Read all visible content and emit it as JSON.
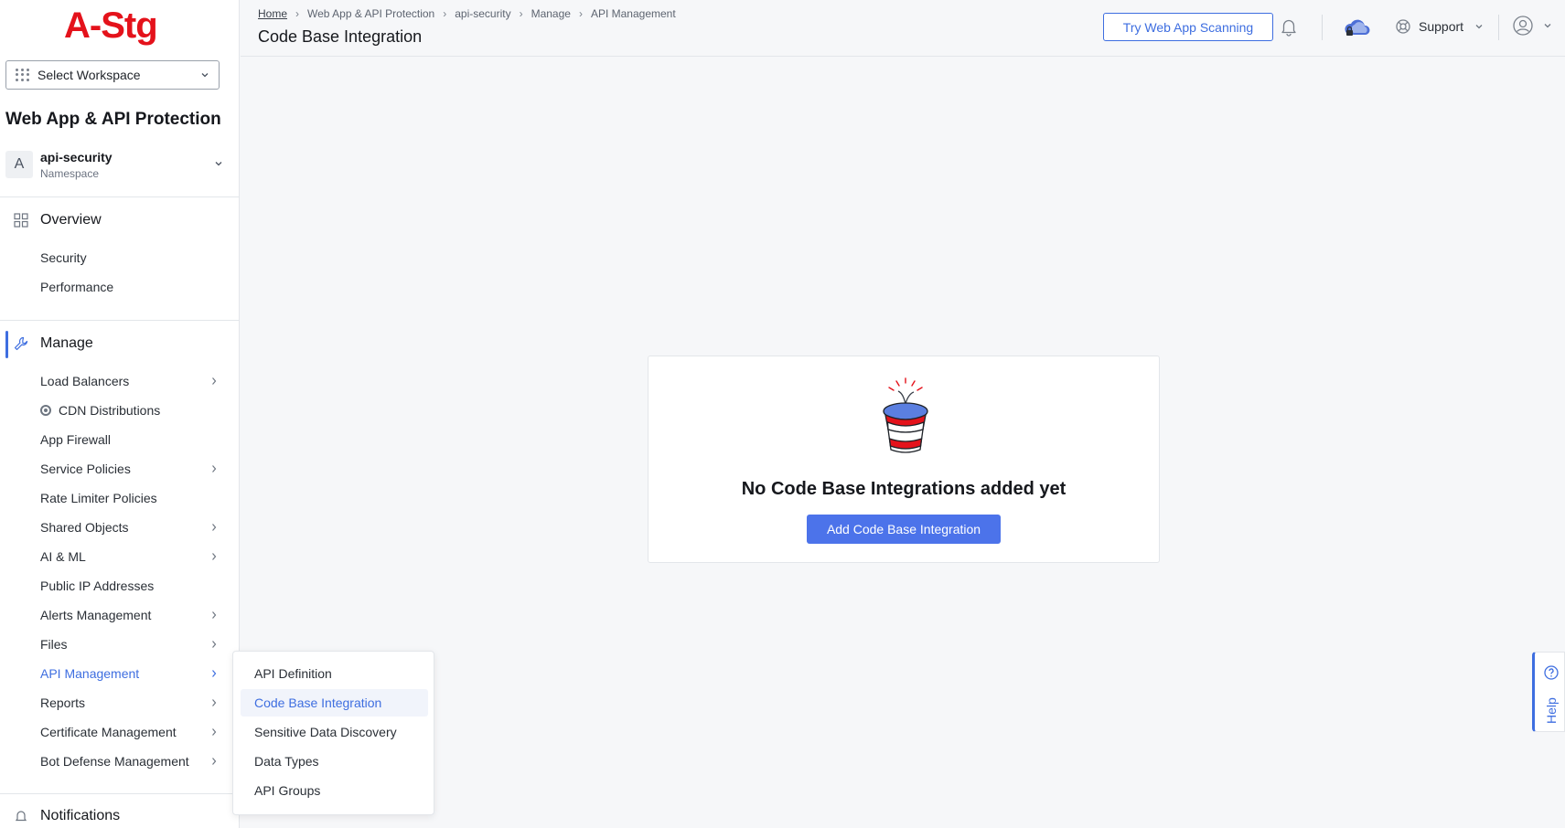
{
  "brand": {
    "logo_text": "A-Stg",
    "logo_color": "#e4121b",
    "accent": "#3e6ee0"
  },
  "workspace": {
    "label": "Select Workspace"
  },
  "app": {
    "title": "Web App & API Protection"
  },
  "namespace": {
    "avatar": "A",
    "name": "api-security",
    "sub": "Namespace"
  },
  "sidebar": {
    "overview": {
      "label": "Overview",
      "items": [
        {
          "label": "Security"
        },
        {
          "label": "Performance"
        }
      ]
    },
    "manage": {
      "label": "Manage",
      "items": [
        {
          "label": "Load Balancers",
          "has_arrow": true
        },
        {
          "label": "CDN Distributions",
          "has_arrow": false
        },
        {
          "label": "App Firewall",
          "has_arrow": false
        },
        {
          "label": "Service Policies",
          "has_arrow": true
        },
        {
          "label": "Rate Limiter Policies",
          "has_arrow": false
        },
        {
          "label": "Shared Objects",
          "has_arrow": true
        },
        {
          "label": "AI & ML",
          "has_arrow": true
        },
        {
          "label": "Public IP Addresses",
          "has_arrow": false
        },
        {
          "label": "Alerts Management",
          "has_arrow": true
        },
        {
          "label": "Files",
          "has_arrow": true
        },
        {
          "label": "API Management",
          "has_arrow": true,
          "active": true
        },
        {
          "label": "Reports",
          "has_arrow": true
        },
        {
          "label": "Certificate Management",
          "has_arrow": true
        },
        {
          "label": "Bot Defense Management",
          "has_arrow": true
        }
      ]
    },
    "notifications": {
      "label": "Notifications"
    }
  },
  "header": {
    "breadcrumb": [
      "Home",
      "Web App & API Protection",
      "api-security",
      "Manage",
      "API Management"
    ],
    "page_title": "Code Base Integration",
    "try_button": "Try Web App Scanning",
    "support_label": "Support"
  },
  "empty_state": {
    "title": "No Code Base Integrations added yet",
    "button": "Add Code Base Integration"
  },
  "flyout": {
    "items": [
      {
        "label": "API Definition"
      },
      {
        "label": "Code Base Integration",
        "selected": true
      },
      {
        "label": "Sensitive Data Discovery"
      },
      {
        "label": "Data Types"
      },
      {
        "label": "API Groups"
      }
    ]
  },
  "help": {
    "label": "Help"
  },
  "icons": [
    "grid-icon",
    "chevron-down-icon",
    "overview-grid-icon",
    "wrench-icon",
    "chevron-right-icon",
    "cdn-icon",
    "bell-icon",
    "cloud-status-icon",
    "support-lifebuoy-icon",
    "user-avatar-icon",
    "help-question-icon",
    "bell-outline-icon"
  ]
}
